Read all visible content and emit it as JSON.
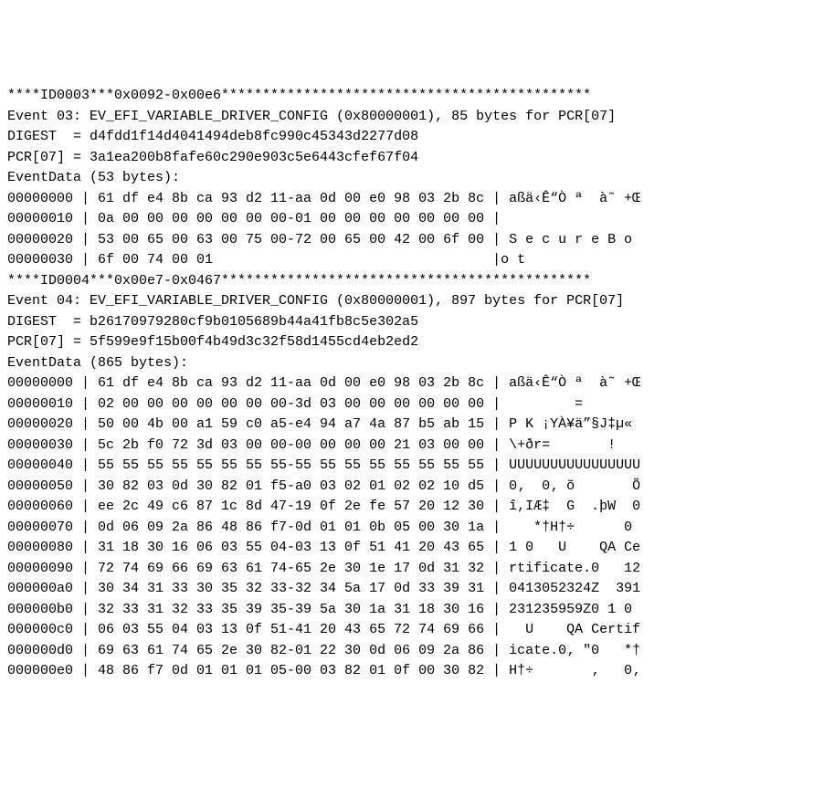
{
  "lines": [
    "****ID0003***0x0092-0x00e6*********************************************",
    "Event 03: EV_EFI_VARIABLE_DRIVER_CONFIG (0x80000001), 85 bytes for PCR[07]",
    "DIGEST  = d4fdd1f14d4041494deb8fc990c45343d2277d08",
    "PCR[07] = 3a1ea200b8fafe60c290e903c5e6443cfef67f04",
    "EventData (53 bytes):",
    "00000000 | 61 df e4 8b ca 93 d2 11-aa 0d 00 e0 98 03 2b 8c | aßä‹Ê“Ò ª  à˜ +Œ",
    "00000010 | 0a 00 00 00 00 00 00 00-01 00 00 00 00 00 00 00 |                 ",
    "00000020 | 53 00 65 00 63 00 75 00-72 00 65 00 42 00 6f 00 | S e c u r e B o ",
    "00000030 | 6f 00 74 00 01                                  |o t",
    "****ID0004***0x00e7-0x0467*********************************************",
    "Event 04: EV_EFI_VARIABLE_DRIVER_CONFIG (0x80000001), 897 bytes for PCR[07]",
    "DIGEST  = b26170979280cf9b0105689b44a41fb8c5e302a5",
    "PCR[07] = 5f599e9f15b00f4b49d3c32f58d1455cd4eb2ed2",
    "EventData (865 bytes):",
    "00000000 | 61 df e4 8b ca 93 d2 11-aa 0d 00 e0 98 03 2b 8c | aßä‹Ê“Ò ª  à˜ +Œ",
    "00000010 | 02 00 00 00 00 00 00 00-3d 03 00 00 00 00 00 00 |         =       ",
    "00000020 | 50 00 4b 00 a1 59 c0 a5-e4 94 a7 4a 87 b5 ab 15 | P K ¡YÀ¥ä”§J‡µ«",
    "00000030 | 5c 2b f0 72 3d 03 00 00-00 00 00 00 21 03 00 00 | \\+ðr=       !   ",
    "00000040 | 55 55 55 55 55 55 55 55-55 55 55 55 55 55 55 55 | UUUUUUUUUUUUUUUU",
    "00000050 | 30 82 03 0d 30 82 01 f5-a0 03 02 01 02 02 10 d5 | 0‚  0‚ õ       Õ",
    "00000060 | ee 2c 49 c6 87 1c 8d 47-19 0f 2e fe 57 20 12 30 | î,IÆ‡  G  .þW  0",
    "00000070 | 0d 06 09 2a 86 48 86 f7-0d 01 01 0b 05 00 30 1a |    *†H†÷      0 ",
    "00000080 | 31 18 30 16 06 03 55 04-03 13 0f 51 41 20 43 65 | 1 0   U    QA Ce",
    "00000090 | 72 74 69 66 69 63 61 74-65 2e 30 1e 17 0d 31 32 | rtificate.0   12",
    "000000a0 | 30 34 31 33 30 35 32 33-32 34 5a 17 0d 33 39 31 | 0413052324Z  391",
    "000000b0 | 32 33 31 32 33 35 39 35-39 5a 30 1a 31 18 30 16 | 231235959Z0 1 0 ",
    "000000c0 | 06 03 55 04 03 13 0f 51-41 20 43 65 72 74 69 66 |   U    QA Certif",
    "000000d0 | 69 63 61 74 65 2e 30 82-01 22 30 0d 06 09 2a 86 | icate.0‚ \"0   *†",
    "000000e0 | 48 86 f7 0d 01 01 01 05-00 03 82 01 0f 00 30 82 | H†÷       ‚   0‚"
  ]
}
